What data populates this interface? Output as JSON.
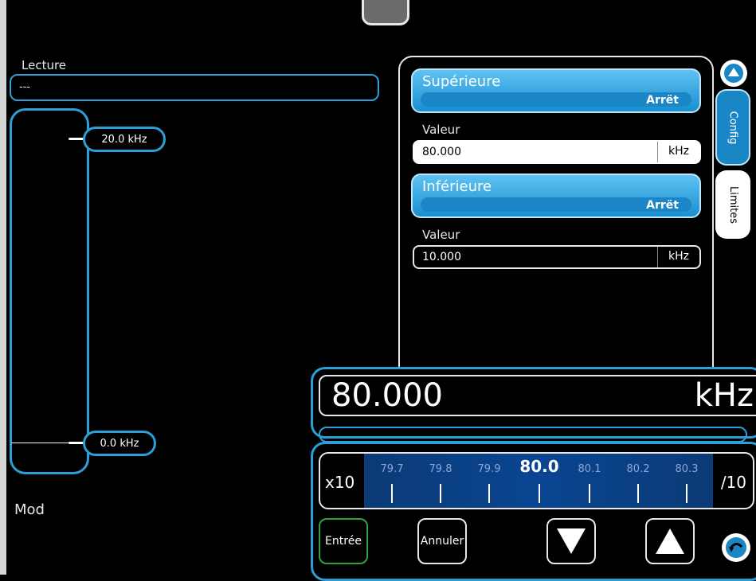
{
  "reading": {
    "label": "Lecture",
    "value": "---"
  },
  "meter": {
    "upper_label": "20.0 kHz",
    "lower_label": "0.0 kHz"
  },
  "mode_label": "Mod",
  "limits_panel": {
    "upper": {
      "title": "Supérieure",
      "state": "Arrët",
      "value_label": "Valeur",
      "value": "80.000",
      "unit": "kHz"
    },
    "lower": {
      "title": "Inférieure",
      "state": "Arrët",
      "value_label": "Valeur",
      "value": "10.000",
      "unit": "kHz"
    }
  },
  "side_tabs": {
    "config": "Config",
    "limits": "Limites"
  },
  "entry": {
    "value": "80.000",
    "unit": "kHz"
  },
  "dial": {
    "left_label": "x10",
    "right_label": "/10",
    "ticks": [
      "79.7",
      "79.8",
      "79.9",
      "80.0",
      "80.1",
      "80.2",
      "80.3"
    ],
    "current": "80.0"
  },
  "keypad": {
    "enter": "Entrée",
    "cancel": "Annuler"
  },
  "colors": {
    "accent": "#2a9fd8",
    "limit_button": "#3aa9e6",
    "dial_bg": "#0a4592"
  },
  "icons": [
    "scroll-up-icon",
    "arrow-down-icon",
    "arrow-up-icon",
    "return-icon"
  ]
}
